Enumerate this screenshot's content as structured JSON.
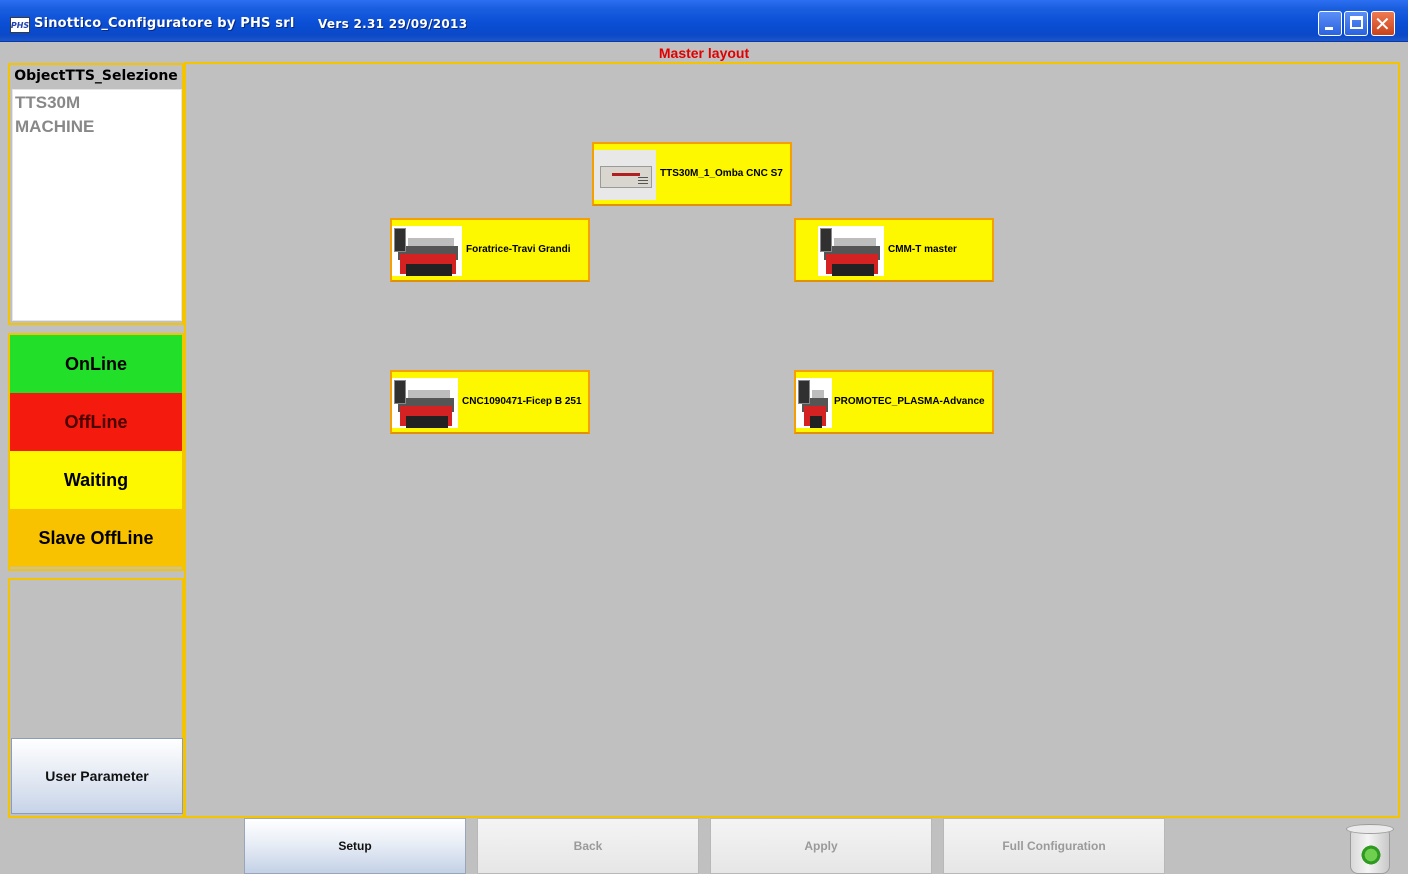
{
  "window": {
    "title": "Sinottico_Configuratore by PHS srl",
    "version": "Vers 2.31  29/09/2013",
    "app_icon_text": "PHS"
  },
  "header": {
    "label": "Master layout"
  },
  "selection": {
    "title": "ObjectTTS_Selezione",
    "items": [
      "TTS30M",
      "MACHINE"
    ]
  },
  "legend": {
    "online": "OnLine",
    "offline": "OffLine",
    "waiting": "Waiting",
    "slave_offline": "Slave OffLine"
  },
  "user_parameter_label": "User Parameter",
  "nodes": [
    {
      "label": "TTS30M_1_Omba CNC S7",
      "icon": "server-unit-icon"
    },
    {
      "label": "Foratrice-Travi Grandi",
      "icon": "lathe-machine-icon"
    },
    {
      "label": "CMM-T master",
      "icon": "lathe-machine-icon"
    },
    {
      "label": "CNC1090471-Ficep B 251",
      "icon": "lathe-machine-icon"
    },
    {
      "label": "PROMOTEC_PLASMA-Advance",
      "icon": "lathe-machine-icon"
    }
  ],
  "toolbar": {
    "setup": "Setup",
    "back": "Back",
    "apply": "Apply",
    "full_configuration": "Full Configuration"
  },
  "colors": {
    "online": "#22e02a",
    "offline": "#f51a0e",
    "waiting": "#fdf800",
    "slave_offline": "#f8c200",
    "border_accent": "#f5c400",
    "header_text": "#e00000"
  }
}
